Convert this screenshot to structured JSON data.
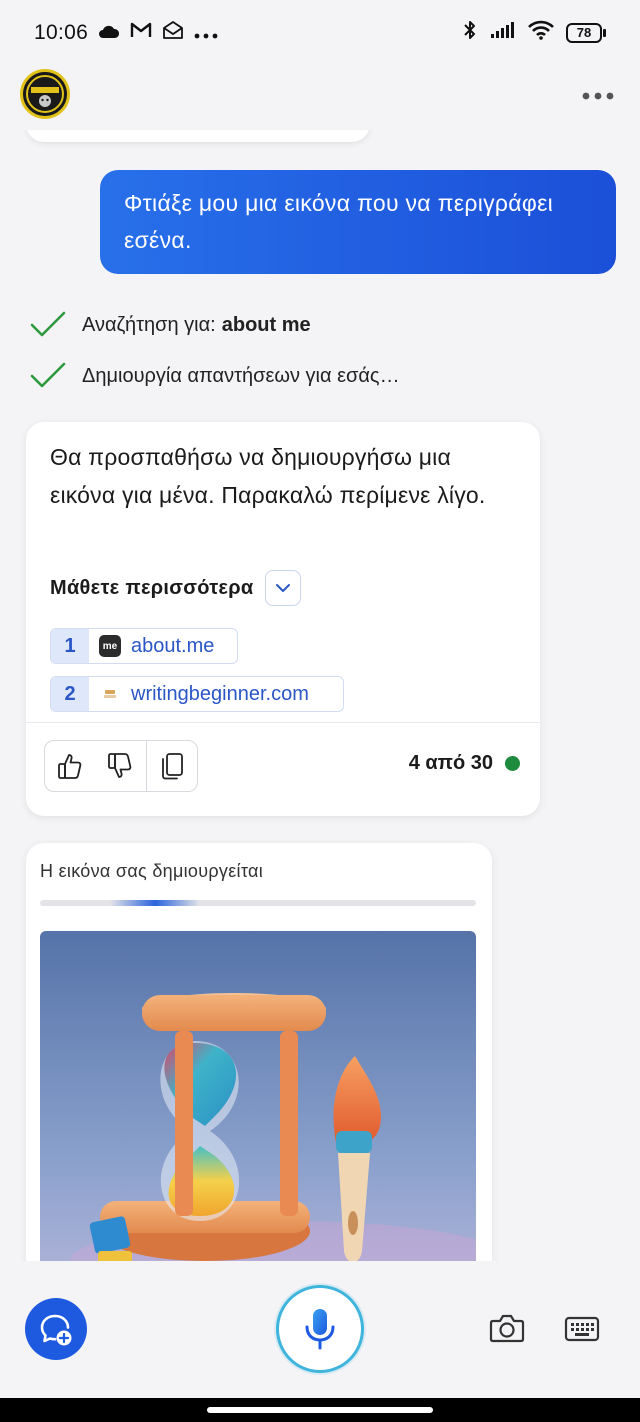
{
  "status": {
    "time": "10:06",
    "battery": "78"
  },
  "chat": {
    "user_message": "Φτιάξε μου μια εικόνα που να περιγράφει εσένα.",
    "steps": [
      {
        "label": "Αναζήτηση για:",
        "bold": "about me"
      },
      {
        "label": "Δημιουργία απαντήσεων για εσάς…",
        "bold": ""
      }
    ],
    "answer": {
      "text": "Θα προσπαθήσω να δημιουργήσω μια εικόνα για μένα. Παρακαλώ περίμενε λίγο.",
      "learn_more": "Μάθετε περισσότερα",
      "sources": [
        {
          "num": "1",
          "badge": "me",
          "label": "about.me"
        },
        {
          "num": "2",
          "badge": "",
          "label": "writingbeginner.com"
        }
      ],
      "counter": "4 από 30",
      "counter_color": "#1d8a3e"
    },
    "image_card": {
      "title": "Η εικόνα σας δημιουργείται"
    }
  },
  "icons": {
    "status_left": [
      "cloud-icon",
      "gmail-icon",
      "mail-open-icon",
      "more-horizontal-icon"
    ],
    "status_right": [
      "bluetooth-icon",
      "signal-icon",
      "wifi-icon",
      "battery-icon"
    ],
    "bottom": [
      "new-chat-icon",
      "microphone-icon",
      "camera-icon",
      "keyboard-icon"
    ]
  },
  "colors": {
    "accent": "#1e5ae0",
    "user_bubble": "#2268e6",
    "check": "#2e9a40",
    "mic_ring": "#3fb4dc"
  }
}
